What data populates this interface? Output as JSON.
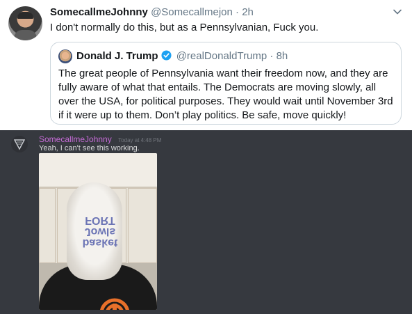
{
  "tweet": {
    "display_name": "SomecallmeJohnny",
    "handle": "@Somecallmejon",
    "separator": "·",
    "time": "2h",
    "text": "I don't normally do this, but as a Pennsylvanian, Fuck you.",
    "quote": {
      "display_name": "Donald J. Trump",
      "handle": "@realDonaldTrump",
      "separator": "·",
      "time": "8h",
      "text": "The great people of Pennsylvania want their freedom now, and they are fully aware of what that entails. The Democrats are moving slowly, all over the USA, for political purposes. They would wait until November 3rd if it were up to them. Don’t play politics. Be safe, move quickly!"
    }
  },
  "discord": {
    "username": "SomecallmeJohnny",
    "timestamp": "Today at 4:48 PM",
    "message": "Yeah, I can't see this working.",
    "bag_print": "basket\nJowls\nFORT",
    "username_color": "#c56bd6"
  }
}
